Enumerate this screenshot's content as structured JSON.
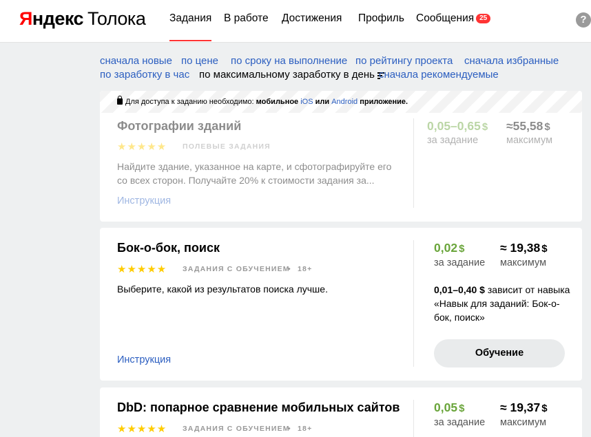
{
  "header": {
    "logo_brand_first": "Я",
    "logo_brand_rest": "ндекс",
    "logo_product": "Толока",
    "nav": [
      {
        "label": "Задания",
        "active": true
      },
      {
        "label": "В работе",
        "active": false
      },
      {
        "label": "Достижения",
        "active": false
      },
      {
        "label": "Профиль",
        "active": false
      },
      {
        "label": "Сообщения",
        "active": false
      }
    ],
    "messages_count": "25",
    "help_icon": "?"
  },
  "sort_options": {
    "row1": [
      "сначала новые",
      "по цене",
      "по сроку на выполнение",
      "по рейтингу проекта",
      "сначала избранные"
    ],
    "row2": [
      "по заработку в час",
      "по максимальному заработку в день",
      "сначала рекомендуемые"
    ],
    "current": "по максимальному заработку в день"
  },
  "tasks": [
    {
      "notice_prefix": "Для доступа к заданию необходимо:",
      "notice_bold": "мобильное",
      "notice_ios": "iOS",
      "notice_or": "или",
      "notice_android": "Android",
      "notice_suffix": "приложение.",
      "title": "Фотографии зданий",
      "stars": "★★★★★",
      "tag": "полевые задания",
      "description": "Найдите здание, указанное на карте, и сфотографируйте его со всех сторон. Получайте 20% к стоимости задания за...",
      "instruction": "Инструкция",
      "price": "0,05–0,65",
      "price_currency": "$",
      "price_caption": "за задание",
      "max": "≈55,58",
      "max_currency": "$",
      "max_caption": "максимум"
    },
    {
      "title": "Бок-о-бок, поиск",
      "stars": "★★★★★",
      "tag": "задания с обучением",
      "dot": "•",
      "age": "18+",
      "description": "Выберите, какой из результатов поиска лучше.",
      "instruction": "Инструкция",
      "price": "0,02",
      "price_currency": "$",
      "price_caption": "за задание",
      "max": "≈ 19,38",
      "max_currency": "$",
      "max_caption": "максимум",
      "skill_range": "0,01–0,40 $",
      "skill_text": "зависит от навыка «Навык для заданий: Бок-о-бок, поиск»",
      "button": "Обучение"
    },
    {
      "title": "DbD: попарное сравнение мобильных сайтов",
      "stars": "★★★★★",
      "tag": "задания с обучением",
      "dot": "•",
      "age": "18+",
      "price": "0,05",
      "price_currency": "$",
      "price_caption": "за задание",
      "max": "≈ 19,37",
      "max_currency": "$",
      "max_caption": "максимум"
    }
  ],
  "colors": {
    "link": "#2b5ec0",
    "price_green": "#6aa53b",
    "star": "#ffcc00",
    "accent_red": "#ff3333"
  }
}
